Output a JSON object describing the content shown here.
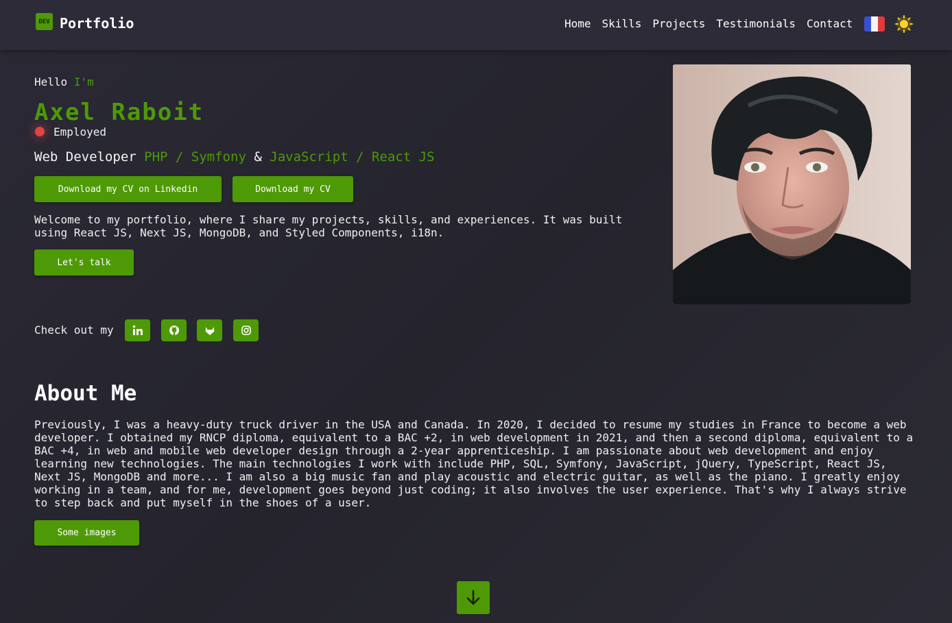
{
  "header": {
    "logo_badge": "DEV",
    "logo_text": "Portfolio",
    "nav": [
      "Home",
      "Skills",
      "Projects",
      "Testimonials",
      "Contact"
    ],
    "language_icon": "french-flag-icon",
    "theme_icon": "sun-icon"
  },
  "hero": {
    "hello": "Hello",
    "im": "I'm",
    "name": "Axel Raboit",
    "status": "Employed",
    "role_prefix": "Web Developer",
    "stack1": "PHP / Symfony",
    "amp": "&",
    "stack2": "JavaScript / React JS",
    "btn_linkedin_cv": "Download my CV on Linkedin",
    "btn_cv": "Download my CV",
    "intro": "Welcome to my portfolio, where I share my projects, skills, and experiences. It was built using React JS, Next JS, MongoDB, and Styled Components, i18n.",
    "btn_talk": "Let's talk",
    "checkout": "Check out my",
    "socials": [
      "linkedin-icon",
      "github-icon",
      "gitlab-icon",
      "instagram-icon"
    ]
  },
  "about": {
    "title": "About Me",
    "text": "Previously, I was a heavy-duty truck driver in the USA and Canada. In 2020, I decided to resume my studies in France to become a web developer. I obtained my RNCP diploma, equivalent to a BAC +2, in web development in 2021, and then a second diploma, equivalent to a BAC +4, in web and mobile web developer design through a 2-year apprenticeship. I am passionate about web development and enjoy learning new technologies. The main technologies I work with include PHP, SQL, Symfony, JavaScript, jQuery, TypeScript, React JS, Next JS, MongoDB and more... I am also a big music fan and play acoustic and electric guitar, as well as the piano. I greatly enjoy working in a team, and for me, development goes beyond just coding; it also involves the user experience. That's why I always strive to step back and put myself in the shoes of a user.",
    "btn_images": "Some images"
  },
  "scroll_icon": "arrow-down-icon",
  "colors": {
    "accent": "#4e9a06",
    "background": "#27262f",
    "status": "#e04545"
  }
}
